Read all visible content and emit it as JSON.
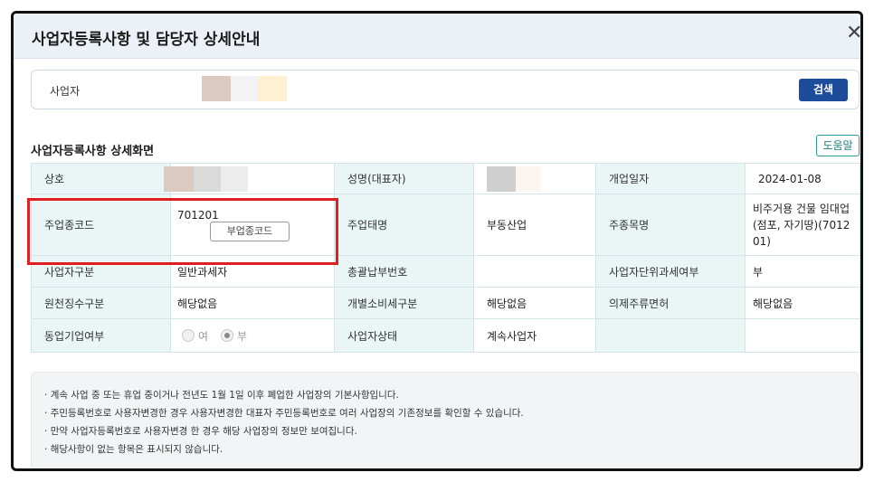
{
  "dialog": {
    "title": "사업자등록사항 및 담당자 상세안내",
    "close": "✕"
  },
  "search": {
    "label": "사업자",
    "button": "검색"
  },
  "section": {
    "title": "사업자등록사항 상세화면",
    "help": "도움말"
  },
  "table": {
    "r1": {
      "l1": "상호",
      "l2": "성명(대표자)",
      "l3": "개업일자",
      "v3": "2024-01-08"
    },
    "r2": {
      "l1": "주업종코드",
      "v1": "701201",
      "sub_button": "부업종코드",
      "l2": "주업태명",
      "v2": "부동산업",
      "l3": "주종목명",
      "v3": "비주거용 건물 임대업(점포, 자기땅)(701201)"
    },
    "r3": {
      "l1": "사업자구분",
      "v1": "일반과세자",
      "l2": "총괄납부번호",
      "v2": "",
      "l3": "사업자단위과세여부",
      "v3": "부"
    },
    "r4": {
      "l1": "원천징수구분",
      "v1": "해당없음",
      "l2": "개별소비세구분",
      "v2": "해당없음",
      "l3": "의제주류면허",
      "v3": "해당없음"
    },
    "r5": {
      "l1": "동업기업여부",
      "opt_yes": "여",
      "opt_no": "부",
      "l2": "사업자상태",
      "v2": "계속사업자"
    }
  },
  "notice": [
    "계속 사업 중 또는 휴업 중이거나 전년도 1월 1일 이후 폐업한 사업장의 기본사항입니다.",
    "주민등록번호로 사용자변경한 경우 사용자변경한 대표자 주민등록번호로 여러 사업장의 기존정보를 확인할 수 있습니다.",
    "만약 사업자등록번호로 사용자변경 한 경우 해당 사업장의 정보만 보여집니다.",
    "해당사항이 없는 항목은 표시되지 않습니다."
  ],
  "colors": {
    "primary": "#1d4c9b",
    "label_bg": "#eaf5f5",
    "highlight": "#e02020",
    "help_border": "#2a9aa1"
  }
}
